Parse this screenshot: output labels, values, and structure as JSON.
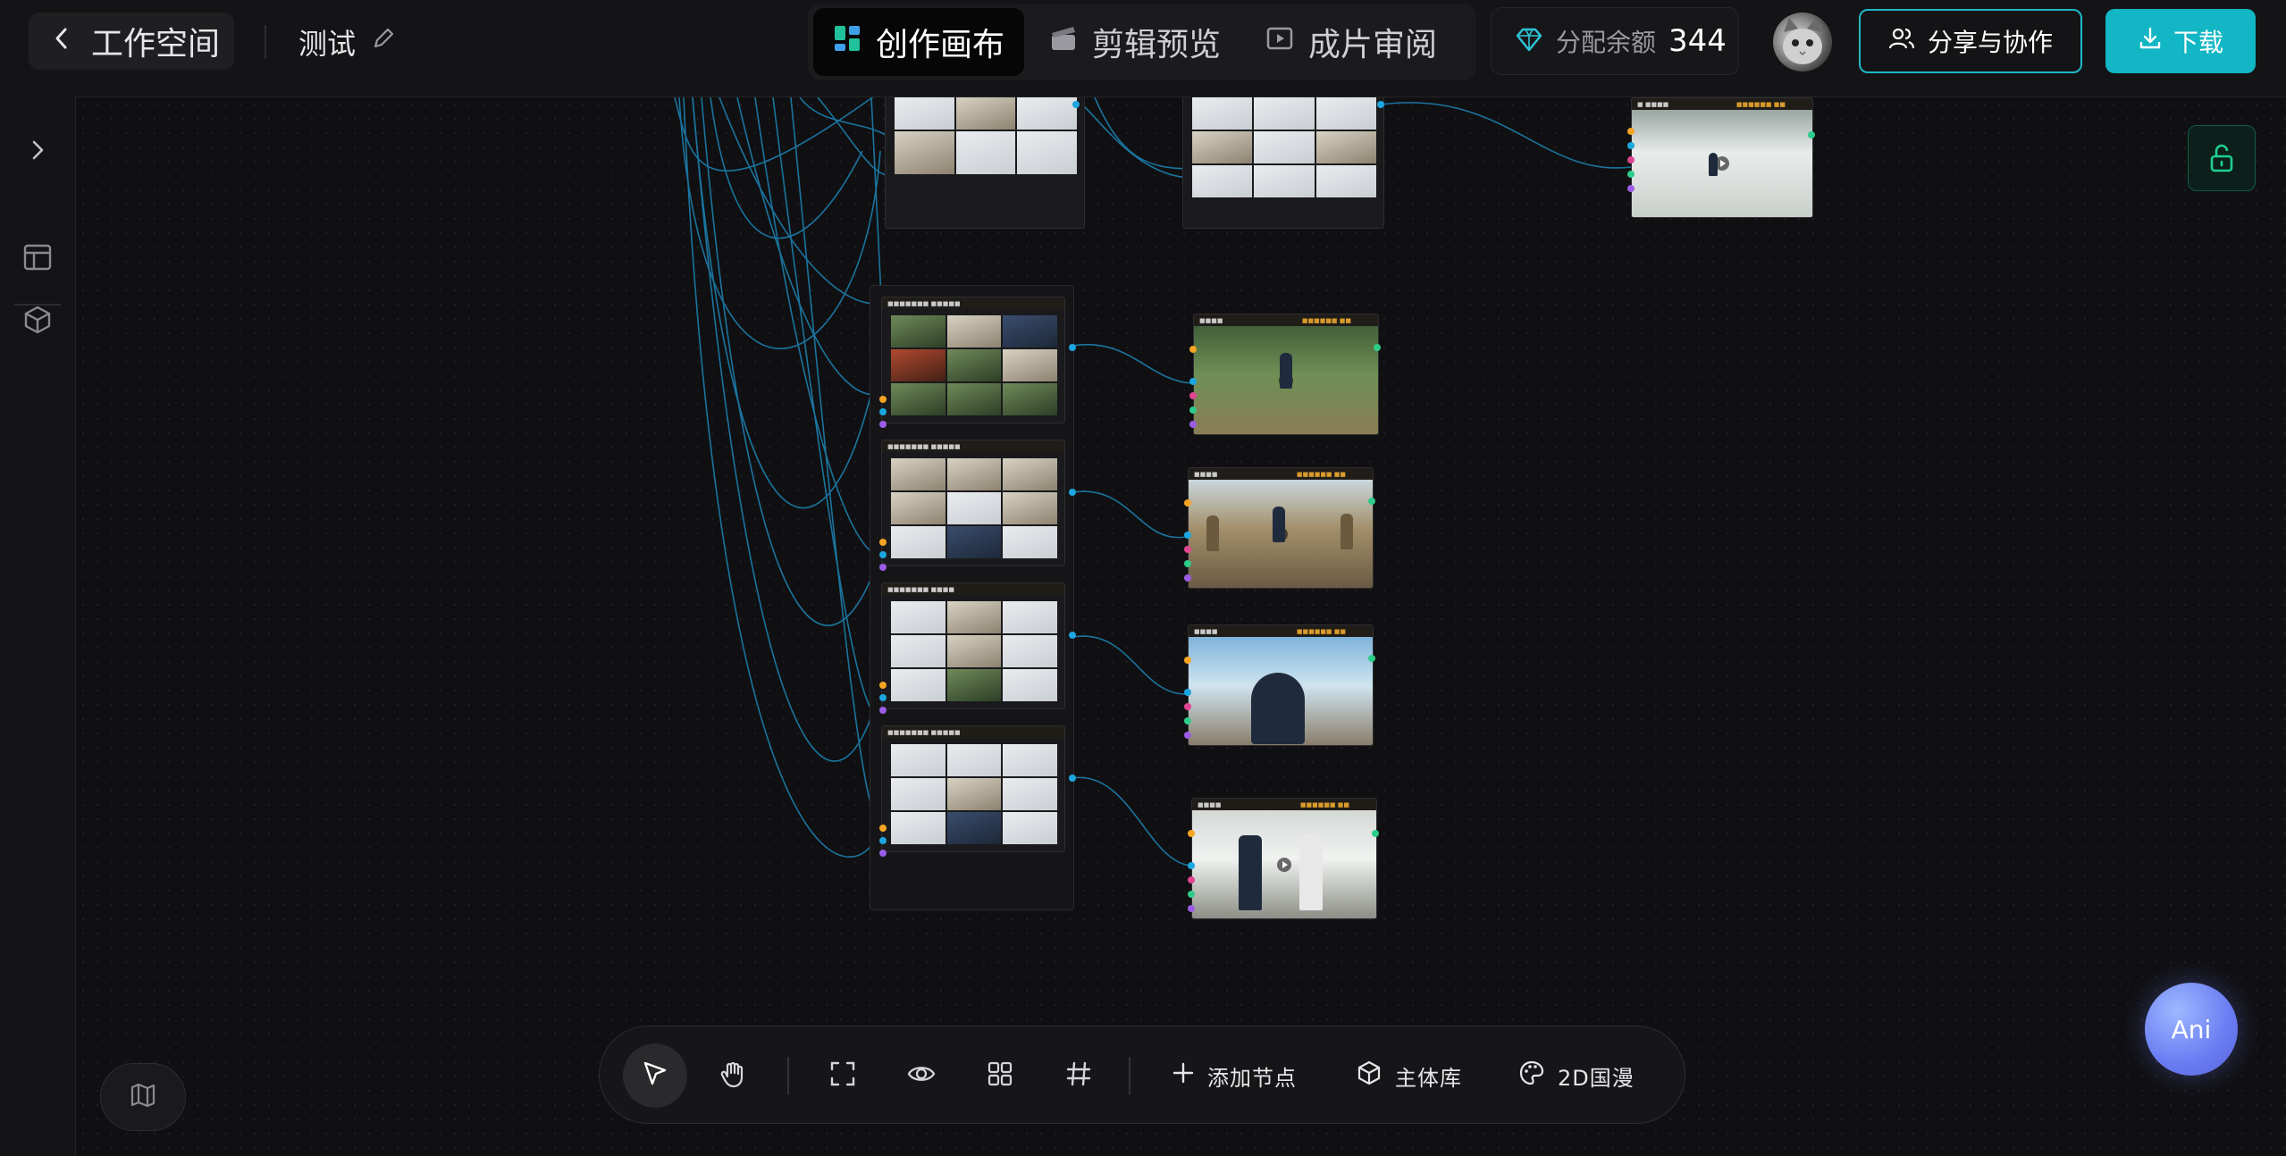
{
  "header": {
    "back_label": "工作空间",
    "project_name": "测试",
    "tabs": [
      {
        "label": "创作画布",
        "active": true
      },
      {
        "label": "剪辑预览",
        "active": false
      },
      {
        "label": "成片审阅",
        "active": false
      }
    ],
    "balance_label": "分配余额",
    "balance_value": "344",
    "share_label": "分享与协作",
    "download_label": "下载"
  },
  "toolbar": {
    "add_node_label": "添加节点",
    "subject_library_label": "主体库",
    "style_label": "2D国漫"
  },
  "assistant": {
    "label": "Ani"
  },
  "colors": {
    "accent": "#12b6c4",
    "wire": "#1d7fae",
    "port_orange": "#f5a524",
    "port_blue": "#1ca6e0",
    "port_pink": "#e0458f",
    "port_green": "#2ecc8a",
    "port_purple": "#9b5de5",
    "node_tag": "#d99a2b"
  },
  "icons": {
    "back": "chevron-left-icon",
    "edit": "pencil-icon",
    "canvas_tab": "grid-icon",
    "edit_tab": "clapper-icon",
    "review_tab": "film-icon",
    "balance": "diamond-icon",
    "share": "users-icon",
    "download": "download-icon",
    "lock": "unlock-icon",
    "expand": "chevron-right-icon",
    "layout": "layout-icon",
    "box": "cube-icon",
    "select": "cursor-icon",
    "pan": "hand-icon",
    "fit": "fullscreen-icon",
    "preview": "eye-icon",
    "arrange": "grid-four-icon",
    "snap": "hash-icon",
    "map": "map-icon",
    "style": "palette-icon"
  }
}
